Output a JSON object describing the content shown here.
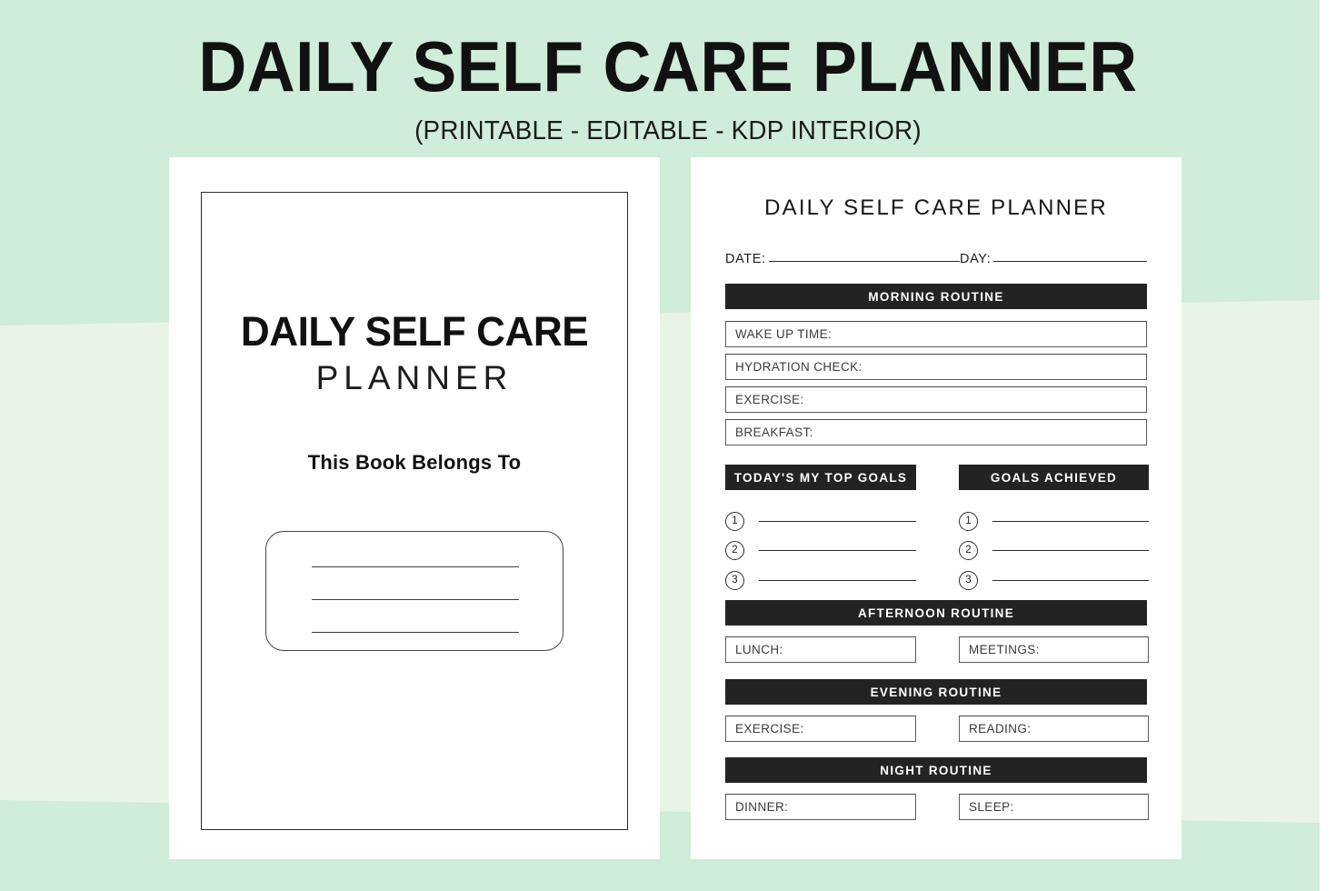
{
  "header": {
    "title": "DAILY SELF CARE PLANNER",
    "subtitle": "(PRINTABLE - EDITABLE - KDP INTERIOR)"
  },
  "colors": {
    "background": "#d0ecdb",
    "background_band": "#e9f3e8",
    "page": "#ffffff",
    "bar_fill": "#232323",
    "bar_text": "#ffffff",
    "ink": "#1a1a1a"
  },
  "cover": {
    "title_line1": "DAILY SELF CARE",
    "title_line2": "PLANNER",
    "belongs_label": "This Book Belongs To",
    "name_lines": [
      "",
      "",
      ""
    ]
  },
  "interior": {
    "title": "DAILY SELF CARE PLANNER",
    "date_label": "DATE:",
    "date_value": "",
    "day_label": "DAY:",
    "day_value": "",
    "morning": {
      "heading": "MORNING ROUTINE",
      "fields": [
        {
          "label": "WAKE UP TIME:",
          "value": ""
        },
        {
          "label": "HYDRATION CHECK:",
          "value": ""
        },
        {
          "label": "EXERCISE:",
          "value": ""
        },
        {
          "label": "BREAKFAST:",
          "value": ""
        }
      ]
    },
    "goals": {
      "left_heading": "TODAY'S MY TOP GOALS",
      "right_heading": "GOALS  ACHIEVED",
      "numbers": [
        "1",
        "2",
        "3"
      ],
      "left_values": [
        "",
        "",
        ""
      ],
      "right_values": [
        "",
        "",
        ""
      ]
    },
    "afternoon": {
      "heading": "AFTERNOON ROUTINE",
      "fields": [
        {
          "label": "LUNCH:",
          "value": ""
        },
        {
          "label": "MEETINGS:",
          "value": ""
        }
      ]
    },
    "evening": {
      "heading": "EVENING ROUTINE",
      "fields": [
        {
          "label": "EXERCISE:",
          "value": ""
        },
        {
          "label": "READING:",
          "value": ""
        }
      ]
    },
    "night": {
      "heading": "NIGHT ROUTINE",
      "fields": [
        {
          "label": "DINNER:",
          "value": ""
        },
        {
          "label": "SLEEP:",
          "value": ""
        }
      ]
    }
  }
}
